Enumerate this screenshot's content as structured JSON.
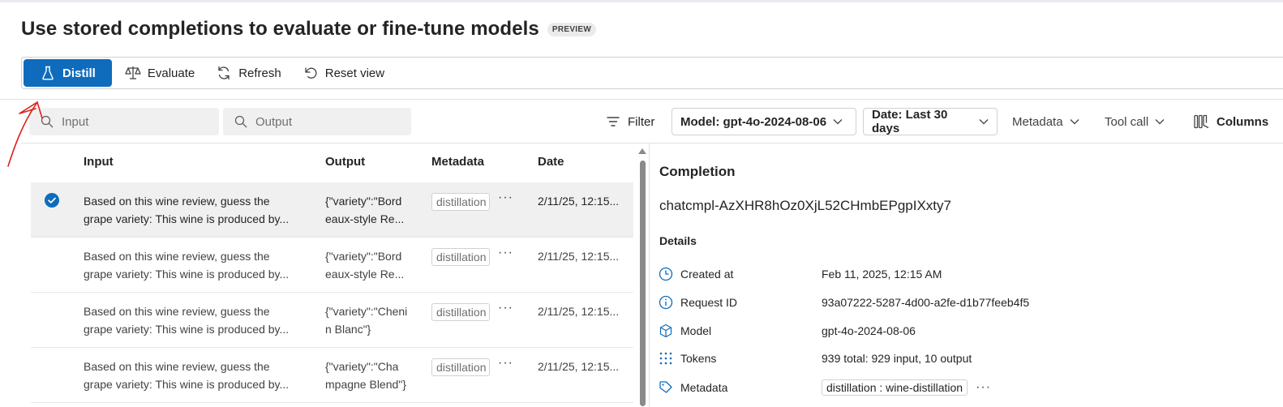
{
  "page": {
    "title": "Use stored completions to evaluate or fine-tune models",
    "badge": "PREVIEW"
  },
  "toolbar": {
    "distill_label": "Distill",
    "evaluate_label": "Evaluate",
    "refresh_label": "Refresh",
    "reset_label": "Reset view"
  },
  "filters": {
    "input_placeholder": "Input",
    "output_placeholder": "Output",
    "filter_label": "Filter",
    "model_label": "Model: gpt-4o-2024-08-06",
    "date_label": "Date: Last 30 days",
    "metadata_label": "Metadata",
    "toolcall_label": "Tool call",
    "columns_label": "Columns"
  },
  "table": {
    "headers": {
      "input": "Input",
      "output": "Output",
      "metadata": "Metadata",
      "date": "Date"
    },
    "rows": [
      {
        "selected": true,
        "input_l1": "Based on this wine review, guess the",
        "input_l2": "grape variety: This wine is produced by...",
        "output_l1": "{\"variety\":\"Bord",
        "output_l2": "eaux-style Re...",
        "metadata": "distillation",
        "more": "···",
        "date": "2/11/25, 12:15..."
      },
      {
        "selected": false,
        "input_l1": "Based on this wine review, guess the",
        "input_l2": "grape variety: This wine is produced by...",
        "output_l1": "{\"variety\":\"Bord",
        "output_l2": "eaux-style Re...",
        "metadata": "distillation",
        "more": "···",
        "date": "2/11/25, 12:15..."
      },
      {
        "selected": false,
        "input_l1": "Based on this wine review, guess the",
        "input_l2": "grape variety: This wine is produced by...",
        "output_l1": "{\"variety\":\"Cheni",
        "output_l2": "n Blanc\"}",
        "metadata": "distillation",
        "more": "···",
        "date": "2/11/25, 12:15..."
      },
      {
        "selected": false,
        "input_l1": "Based on this wine review, guess the",
        "input_l2": "grape variety: This wine is produced by...",
        "output_l1": "{\"variety\":\"Cha",
        "output_l2": "mpagne Blend\"}",
        "metadata": "distillation",
        "more": "···",
        "date": "2/11/25, 12:15..."
      }
    ]
  },
  "detail": {
    "title": "Completion",
    "completion_id": "chatcmpl-AzXHR8hOz0XjL52CHmbEPgpIXxty7",
    "section": "Details",
    "created_label": "Created at",
    "created_value": "Feb 11, 2025, 12:15 AM",
    "request_label": "Request ID",
    "request_value": "93a07222-5287-4d00-a2fe-d1b77feeb4f5",
    "model_label": "Model",
    "model_value": "gpt-4o-2024-08-06",
    "tokens_label": "Tokens",
    "tokens_value": "939 total: 929 input, 10 output",
    "metadata_label": "Metadata",
    "metadata_value": "distillation : wine-distillation",
    "metadata_more": "···"
  },
  "colors": {
    "primary": "#0f6cbd",
    "annotation": "#e0201b"
  }
}
